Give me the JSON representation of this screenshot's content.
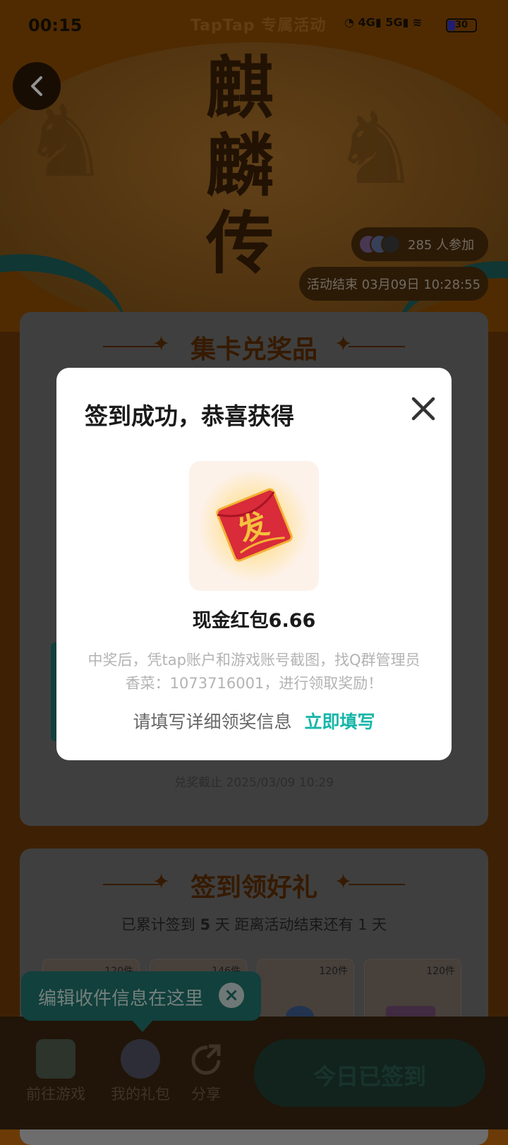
{
  "status_bar": {
    "time": "00:15",
    "brand": "TapTap 专属活动",
    "network_a": "4G",
    "network_b": "5G",
    "battery": "30"
  },
  "header": {
    "title_chars": [
      "麒",
      "麟",
      "传"
    ],
    "participants": "285 人参加",
    "end_time": "活动结束 03月09日 10:28:55"
  },
  "card_collect": {
    "title": "集卡兑奖品",
    "deadline": "兑奖截止 2025/03/09 10:29"
  },
  "card_signin": {
    "title": "签到领好礼",
    "progress_prefix": "已累计签到",
    "progress_days": "5",
    "progress_suffix": "天  距离活动结束还有 1 天",
    "rewards": [
      {
        "count": "120件"
      },
      {
        "count": "146件"
      },
      {
        "count": "120件"
      },
      {
        "count": "120件"
      }
    ]
  },
  "tooltip": {
    "text": "编辑收件信息在这里"
  },
  "bottom_nav": {
    "items": [
      {
        "label": "前往游戏"
      },
      {
        "label": "我的礼包"
      },
      {
        "label": "分享"
      }
    ],
    "signed_button": "今日已签到"
  },
  "modal": {
    "title": "签到成功，恭喜获得",
    "prize_name": "现金红包6.66",
    "prize_desc": "中奖后，凭tap账户和游戏账号截图，找Q群管理员香菜：1073716001，进行领取奖励！",
    "fill_prompt": "请填写详细领奖信息",
    "fill_link": "立即填写",
    "envelope_char": "发"
  },
  "colors": {
    "accent_teal": "#16b6a8",
    "card_title_brown": "#5e2e02",
    "envelope_red": "#d92b3a"
  }
}
